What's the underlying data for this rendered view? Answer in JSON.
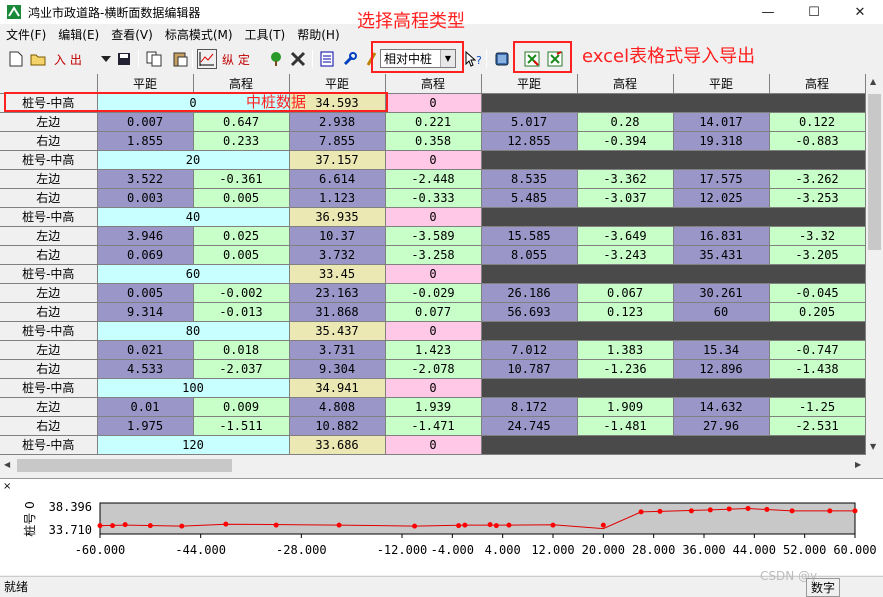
{
  "window": {
    "title": "鸿业市政道路-横断面数据编辑器",
    "minimize": "—",
    "maximize": "☐",
    "close": "✕"
  },
  "menu": [
    "文件(F)",
    "编辑(E)",
    "查看(V)",
    "标高模式(M)",
    "工具(T)",
    "帮助(H)"
  ],
  "toolbar": {
    "import_label": "入 出",
    "vertical_label": "纵 定",
    "elevation_mode": "相对中桩"
  },
  "annotations": {
    "elev_type": "选择高程类型",
    "excel": "excel表格式导入导出",
    "center": "中桩数据"
  },
  "columns": [
    "平距",
    "高程",
    "平距",
    "高程",
    "平距",
    "高程",
    "平距",
    "高程"
  ],
  "row_labels": {
    "center": "桩号-中高",
    "left": "左边",
    "right": "右边"
  },
  "stations": [
    {
      "station": "0",
      "center_dist": "34.593",
      "center_elev": "0",
      "left": [
        "0.007",
        "0.647",
        "2.938",
        "0.221",
        "5.017",
        "0.28",
        "14.017",
        "0.122"
      ],
      "right": [
        "1.855",
        "0.233",
        "7.855",
        "0.358",
        "12.855",
        "-0.394",
        "19.318",
        "-0.883"
      ]
    },
    {
      "station": "20",
      "center_dist": "37.157",
      "center_elev": "0",
      "left": [
        "3.522",
        "-0.361",
        "6.614",
        "-2.448",
        "8.535",
        "-3.362",
        "17.575",
        "-3.262"
      ],
      "right": [
        "0.003",
        "0.005",
        "1.123",
        "-0.333",
        "5.485",
        "-3.037",
        "12.025",
        "-3.253"
      ]
    },
    {
      "station": "40",
      "center_dist": "36.935",
      "center_elev": "0",
      "left": [
        "3.946",
        "0.025",
        "10.37",
        "-3.589",
        "15.585",
        "-3.649",
        "16.831",
        "-3.32"
      ],
      "right": [
        "0.069",
        "0.005",
        "3.732",
        "-3.258",
        "8.055",
        "-3.243",
        "35.431",
        "-3.205"
      ]
    },
    {
      "station": "60",
      "center_dist": "33.45",
      "center_elev": "0",
      "left": [
        "0.005",
        "-0.002",
        "23.163",
        "-0.029",
        "26.186",
        "0.067",
        "30.261",
        "-0.045"
      ],
      "right": [
        "9.314",
        "-0.013",
        "31.868",
        "0.077",
        "56.693",
        "0.123",
        "60",
        "0.205"
      ]
    },
    {
      "station": "80",
      "center_dist": "35.437",
      "center_elev": "0",
      "left": [
        "0.021",
        "0.018",
        "3.731",
        "1.423",
        "7.012",
        "1.383",
        "15.34",
        "-0.747"
      ],
      "right": [
        "4.533",
        "-2.037",
        "9.304",
        "-2.078",
        "10.787",
        "-1.236",
        "12.896",
        "-1.438"
      ]
    },
    {
      "station": "100",
      "center_dist": "34.941",
      "center_elev": "0",
      "left": [
        "0.01",
        "0.009",
        "4.808",
        "1.939",
        "8.172",
        "1.909",
        "14.632",
        "-1.25"
      ],
      "right": [
        "1.975",
        "-1.511",
        "10.882",
        "-1.471",
        "24.745",
        "-1.481",
        "27.96",
        "-2.531"
      ]
    },
    {
      "station": "120",
      "center_dist": "33.686",
      "center_elev": "0",
      "left": null,
      "right": null
    }
  ],
  "profile": {
    "ylabel": "桩号 0",
    "y_ticks": [
      "38.396",
      "33.710"
    ],
    "y_range": [
      33.71,
      38.396
    ],
    "x_range": [
      -60,
      60
    ],
    "x_ticks": [
      "-60.000",
      "-44.000",
      "-28.000",
      "-12.000",
      "-4.000",
      "4.000",
      "12.000",
      "20.000",
      "28.000",
      "36.000",
      "44.000",
      "52.000",
      "60.000"
    ],
    "x_tick_values": [
      -60,
      -44,
      -28,
      -12,
      -4,
      4,
      12,
      20,
      28,
      36,
      44,
      52,
      60
    ],
    "points": [
      [
        -60,
        34.6
      ],
      [
        -58,
        34.6
      ],
      [
        -56,
        34.8
      ],
      [
        -52,
        34.6
      ],
      [
        -47,
        34.5
      ],
      [
        -40,
        34.9
      ],
      [
        -32,
        34.7
      ],
      [
        -22,
        34.7
      ],
      [
        -10,
        34.5
      ],
      [
        -3,
        34.6
      ],
      [
        -2,
        34.7
      ],
      [
        2,
        34.8
      ],
      [
        3,
        34.6
      ],
      [
        5,
        34.7
      ],
      [
        12,
        34.7
      ],
      [
        20,
        34.7
      ],
      [
        26,
        37.4
      ],
      [
        29,
        37.5
      ],
      [
        34,
        37.6
      ],
      [
        37,
        37.8
      ],
      [
        40,
        38.0
      ],
      [
        43,
        38.1
      ],
      [
        46,
        37.9
      ],
      [
        50,
        37.6
      ],
      [
        56,
        37.6
      ],
      [
        60,
        37.6
      ]
    ],
    "curve": [
      [
        -60,
        34.6
      ],
      [
        -56,
        34.7
      ],
      [
        -47,
        34.5
      ],
      [
        -40,
        34.9
      ],
      [
        -22,
        34.7
      ],
      [
        -10,
        34.5
      ],
      [
        -2,
        34.7
      ],
      [
        5,
        34.7
      ],
      [
        12,
        34.8
      ],
      [
        20,
        34.0
      ],
      [
        26,
        37.4
      ],
      [
        29,
        37.5
      ],
      [
        37,
        37.8
      ],
      [
        43,
        38.1
      ],
      [
        50,
        37.6
      ],
      [
        60,
        37.6
      ]
    ]
  },
  "status": {
    "left": "就绪",
    "right": "数字"
  },
  "watermark": "CSDN @y"
}
